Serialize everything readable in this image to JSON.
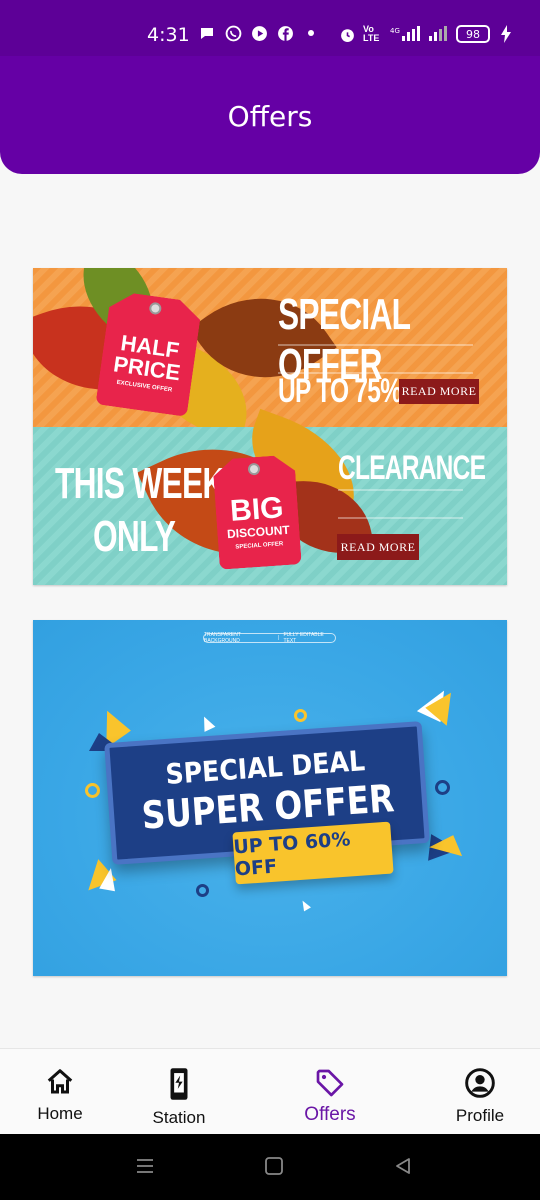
{
  "status_bar": {
    "time": "4:31",
    "battery": "98",
    "network": "Vo LTE",
    "signal": "4G"
  },
  "header": {
    "title": "Offers"
  },
  "banner1": {
    "top": {
      "tag_line1": "HALF",
      "tag_line2": "PRICE",
      "tag_sub": "EXCLUSIVE OFFER",
      "title": "SPECIAL OFFER",
      "subtitle": "UP TO 75%",
      "button": "READ MORE"
    },
    "bottom": {
      "headline1": "THIS WEEK",
      "headline2": "ONLY",
      "tag_line1": "BIG",
      "tag_line2": "DISCOUNT",
      "tag_sub": "SPECIAL OFFER",
      "title": "CLEARANCE",
      "button": "READ MORE"
    }
  },
  "banner2": {
    "top_label_left": "TRANSPARENT BACKGROUND",
    "top_label_right": "FULLY EDITABLE TEXT",
    "line1": "SPECIAL DEAL",
    "line2": "SUPER OFFER",
    "price": "UP TO 60% OFF"
  },
  "bottom_nav": {
    "items": [
      {
        "label": "Home",
        "icon": "home-icon"
      },
      {
        "label": "Station",
        "icon": "charging-station-icon"
      },
      {
        "label": "Offers",
        "icon": "tag-icon",
        "active": true
      },
      {
        "label": "Profile",
        "icon": "profile-icon"
      }
    ]
  },
  "colors": {
    "primary": "#6500a5",
    "active_nav": "#6a16a6",
    "banner_orange": "#f3973f",
    "banner_teal": "#7fd0c7",
    "banner_blue": "#3aa7e6",
    "tag_red": "#e8244b"
  }
}
